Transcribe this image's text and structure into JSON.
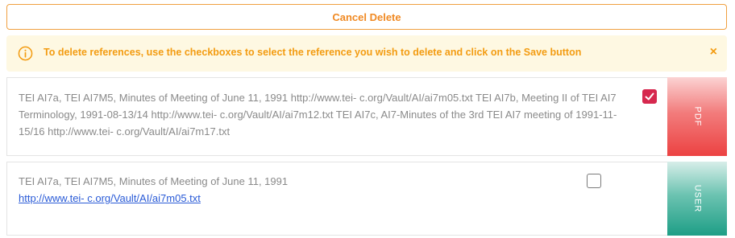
{
  "cancel_button": {
    "label": "Cancel Delete"
  },
  "alert": {
    "message": "To delete references, use the checkboxes to select the reference you wish to delete and click on the Save button",
    "close_symbol": "×",
    "icon": "info-icon"
  },
  "references": [
    {
      "text": "TEI AI7a, TEI AI7M5, Minutes of Meeting of June 11, 1991 http://www.tei- c.org/Vault/AI/ai7m05.txt TEI AI7b, Meeting II of TEI AI7 Terminology, 1991-08-13/14 http://www.tei- c.org/Vault/AI/ai7m12.txt TEI AI7c, AI7-Minutes of the 3rd TEI AI7 meeting of 1991-11-15/16 http://www.tei- c.org/Vault/AI/ai7m17.txt",
      "checked": true,
      "tab_label": "PDF"
    },
    {
      "text": "TEI AI7a, TEI AI7M5, Minutes of Meeting of June 11, 1991",
      "link": "http://www.tei- c.org/Vault/AI/ai7m05.txt",
      "checked": false,
      "tab_label": "USER"
    }
  ],
  "colors": {
    "accent_orange": "#f08a24",
    "alert_bg": "#fef8e2",
    "checkbox_checked": "#d6284e",
    "pdf_tab": "#ec4242",
    "user_tab": "#1e9e86",
    "link": "#2a5bd7"
  }
}
